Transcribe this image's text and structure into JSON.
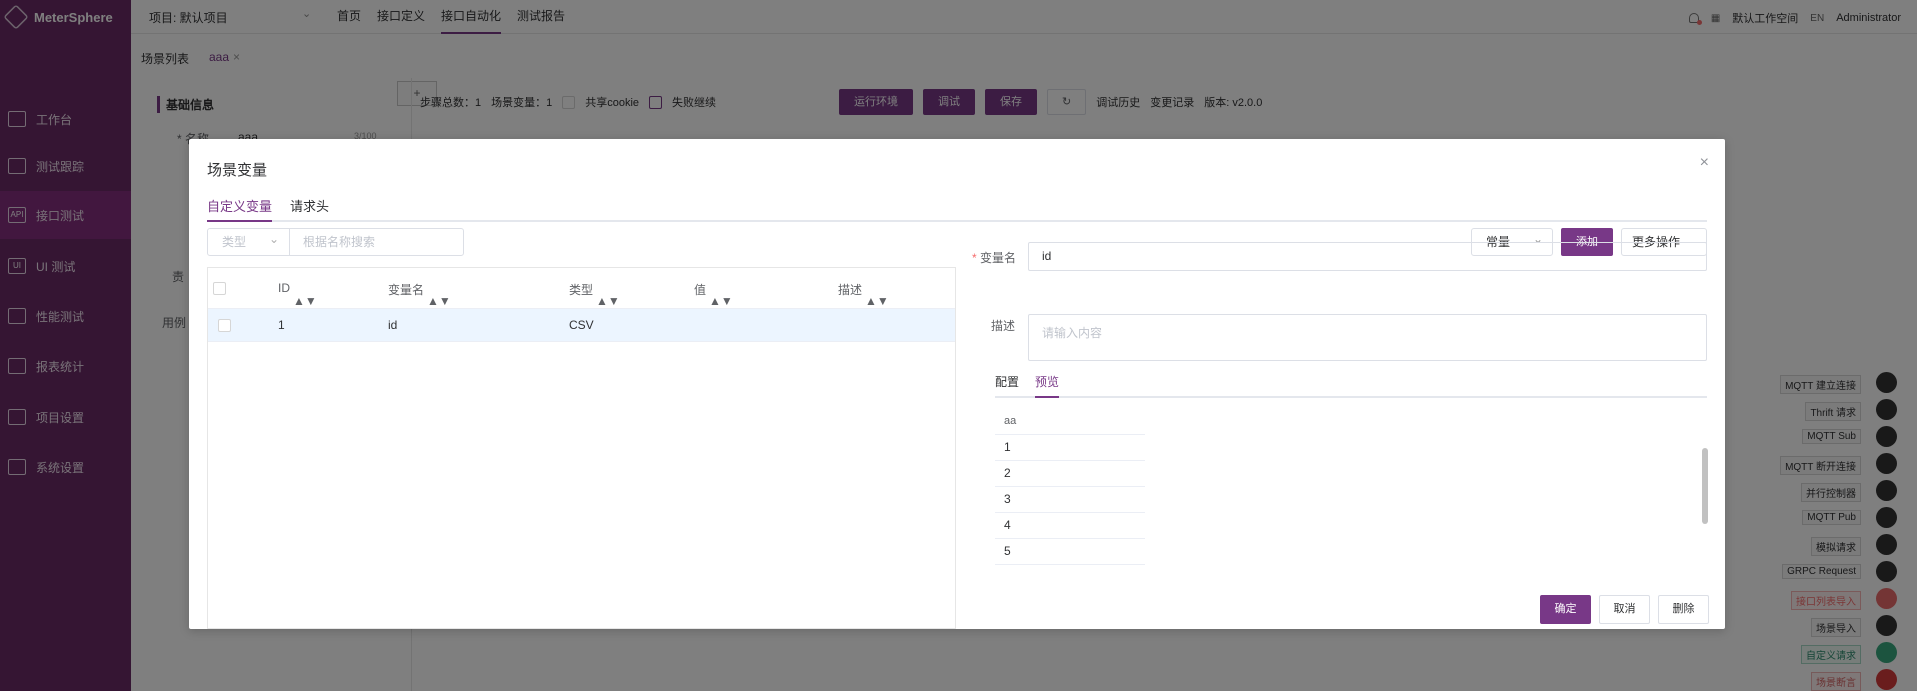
{
  "app": {
    "name": "MeterSphere",
    "project": "项目: 默认项目",
    "workspace": "默认工作空间",
    "lang": "EN",
    "user": "Administrator"
  },
  "sidebar": {
    "items": [
      {
        "label": "工作台",
        "icon": "workbench-icon"
      },
      {
        "label": "测试跟踪",
        "icon": "track-icon"
      },
      {
        "label": "接口测试",
        "icon": "api-icon"
      },
      {
        "label": "UI 测试",
        "icon": "ui-icon"
      },
      {
        "label": "性能测试",
        "icon": "performance-icon"
      },
      {
        "label": "报表统计",
        "icon": "report-icon"
      },
      {
        "label": "项目设置",
        "icon": "project-settings-icon"
      },
      {
        "label": "系统设置",
        "icon": "system-settings-icon"
      }
    ]
  },
  "topnav": [
    "首页",
    "接口定义",
    "接口自动化",
    "测试报告"
  ],
  "tabs": {
    "list": "场景列表",
    "active": "aaa",
    "add": "+"
  },
  "left": {
    "title": "基础信息",
    "name_label": "* 名称",
    "name_value": "aaa",
    "name_count": "3/100",
    "owner": "责",
    "case": "用例"
  },
  "toolbar": {
    "steps": "步骤总数：1",
    "vars": "场景变量：1",
    "share_cookie": "共享cookie",
    "fail_continue": "失败继续",
    "env": "运行环境",
    "debug": "调试",
    "save": "保存",
    "history": "调试历史",
    "changes": "变更记录",
    "version": "版本: v2.0.0"
  },
  "dialog": {
    "title": "场景变量",
    "tabs": [
      "自定义变量",
      "请求头"
    ],
    "filter_type": "类型",
    "filter_placeholder": "根据名称搜索",
    "const_select": "常量",
    "add": "添加",
    "more": "更多操作",
    "headers": [
      "ID",
      "变量名",
      "类型",
      "值",
      "描述"
    ],
    "rows": [
      {
        "id": "1",
        "name": "id",
        "type": "CSV",
        "value": "",
        "description": ""
      }
    ],
    "var_name_label": "* 变量名",
    "var_name_value": "id",
    "desc_label": "描述",
    "desc_placeholder": "请输入内容",
    "mini_tabs": [
      "配置",
      "预览"
    ],
    "preview": [
      "aa",
      "1",
      "2",
      "3",
      "4",
      "5"
    ],
    "confirm": "确定",
    "cancel": "取消",
    "delete": "删除"
  },
  "tools": [
    "MQTT 建立连接",
    "Thrift 请求",
    "MQTT Sub",
    "MQTT 断开连接",
    "并行控制器",
    "MQTT Pub",
    "模拟请求",
    "GRPC Request",
    "接口列表导入",
    "场景导入",
    "自定义请求",
    "场景断言"
  ]
}
